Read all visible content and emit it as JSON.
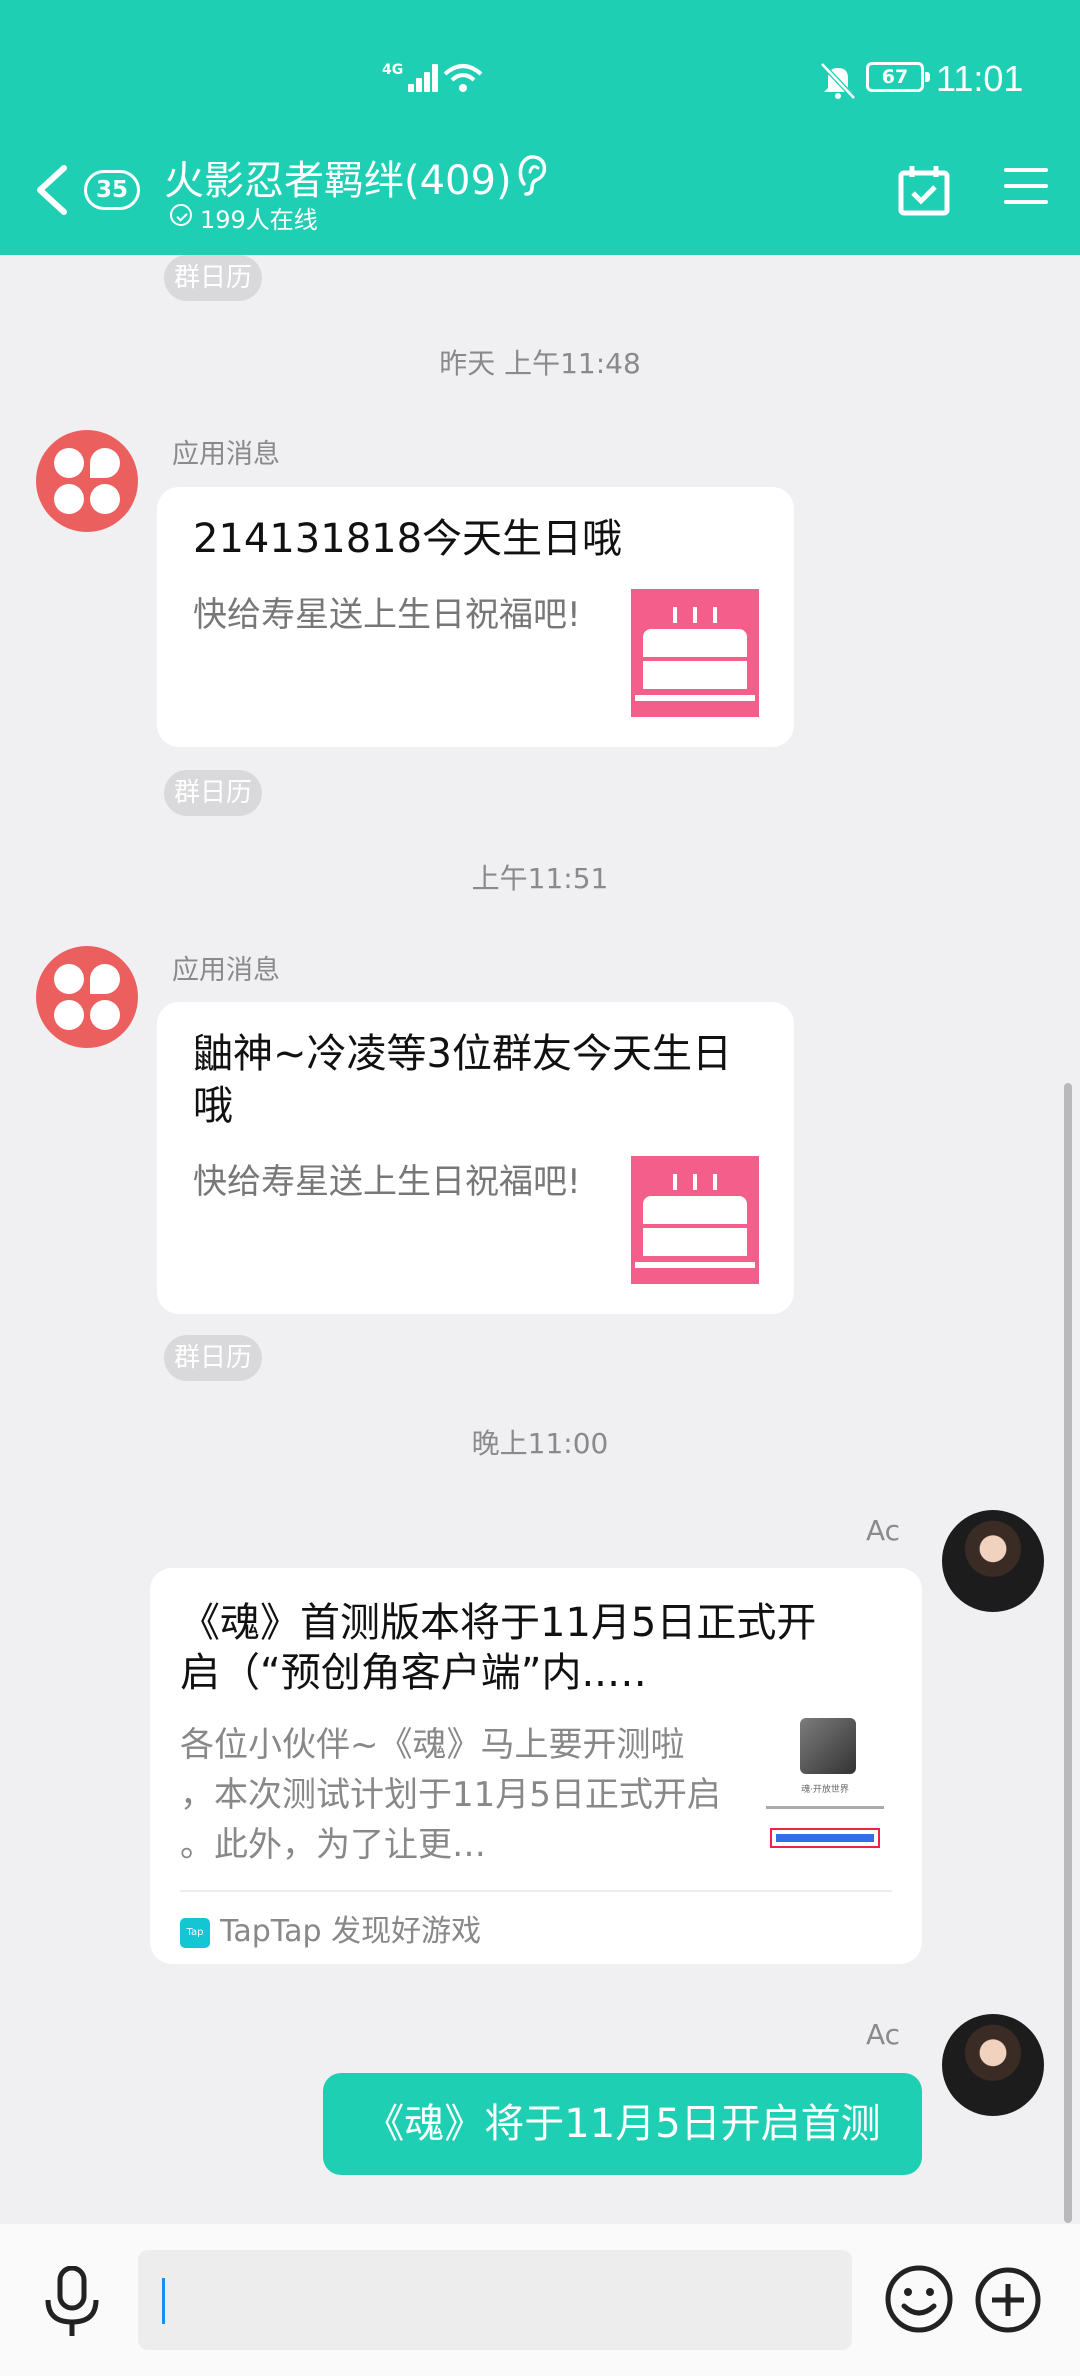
{
  "status_bar": {
    "network": "4G",
    "battery": "67",
    "time": "11:01"
  },
  "header": {
    "unread_badge": "35",
    "group_title": "火影忍者羁绊(409)",
    "online_text": "199人在线",
    "icons": [
      "back-arrow-icon",
      "ear-icon",
      "calendar-check-icon",
      "menu-icon"
    ]
  },
  "chat": {
    "calendar_tag": "群日历",
    "messages": [
      {
        "time": "昨天 上午11:48",
        "sender": "应用消息",
        "title": "214131818今天生日哦",
        "subtitle": "快给寿星送上生日祝福吧!"
      },
      {
        "time": "上午11:51",
        "sender": "应用消息",
        "title": "鼬神~冷凌等3位群友今天生日哦",
        "title_line1": "鼬神~冷凌等3位群友今天生日",
        "title_line2": "哦",
        "subtitle": "快给寿星送上生日祝福吧!"
      }
    ],
    "night_time": "晚上11:00",
    "user_name": "Ac",
    "share_card": {
      "title_line1": "《魂》首测版本将于11月5日正式开",
      "title_line2": "启（“预创角客户端”内..…",
      "desc_line1": "各位小伙伴~《魂》马上要开测啦",
      "desc_line2": "，本次测试计划于11月5日正式开启",
      "desc_line3": "。此外，为了让更…",
      "thumb_caption": "魂·开放世界",
      "source": "TapTap 发现好游戏",
      "source_logo": "Tap"
    },
    "text_message": "《魂》将于11月5日开启首测"
  },
  "input_bar": {
    "icons": [
      "microphone-icon",
      "emoji-icon",
      "plus-icon"
    ]
  }
}
